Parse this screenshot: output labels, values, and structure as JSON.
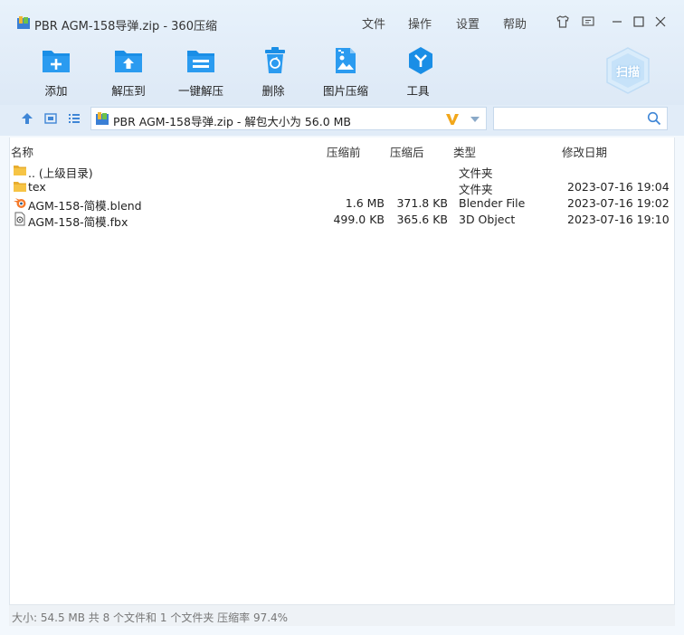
{
  "window": {
    "title": "PBR AGM-158导弹.zip - 360压缩"
  },
  "menu": [
    "文件",
    "操作",
    "设置",
    "帮助"
  ],
  "toolbar": {
    "items": [
      {
        "label": "添加",
        "icon": "add-folder-icon"
      },
      {
        "label": "解压到",
        "icon": "extract-to-icon"
      },
      {
        "label": "一键解压",
        "icon": "one-click-extract-icon"
      },
      {
        "label": "删除",
        "icon": "trash-icon"
      },
      {
        "label": "图片压缩",
        "icon": "image-compress-icon"
      },
      {
        "label": "工具",
        "icon": "tools-icon"
      }
    ],
    "scan_label": "扫描"
  },
  "address": {
    "path": "PBR AGM-158导弹.zip - 解包大小为 56.0 MB",
    "search_placeholder": ""
  },
  "columns": {
    "name": "名称",
    "before": "压缩前",
    "after": "压缩后",
    "type": "类型",
    "modified": "修改日期"
  },
  "files": [
    {
      "name": ".. (上级目录)",
      "before": "",
      "after": "",
      "type": "文件夹",
      "modified": "",
      "icon": "folder-icon"
    },
    {
      "name": "tex",
      "before": "",
      "after": "",
      "type": "文件夹",
      "modified": "2023-07-16 19:04",
      "icon": "folder-icon"
    },
    {
      "name": "AGM-158-简模.blend",
      "before": "1.6 MB",
      "after": "371.8 KB",
      "type": "Blender File",
      "modified": "2023-07-16 19:02",
      "icon": "blender-icon"
    },
    {
      "name": "AGM-158-简模.fbx",
      "before": "499.0 KB",
      "after": "365.6 KB",
      "type": "3D Object",
      "modified": "2023-07-16 19:10",
      "icon": "fbx-file-icon"
    }
  ],
  "status": "大小: 54.5 MB 共 8 个文件和 1 个文件夹 压缩率 97.4%",
  "colors": {
    "accent": "#1a8ee6",
    "titlebar": "#e6f0fa",
    "folder": "#f6c445"
  }
}
